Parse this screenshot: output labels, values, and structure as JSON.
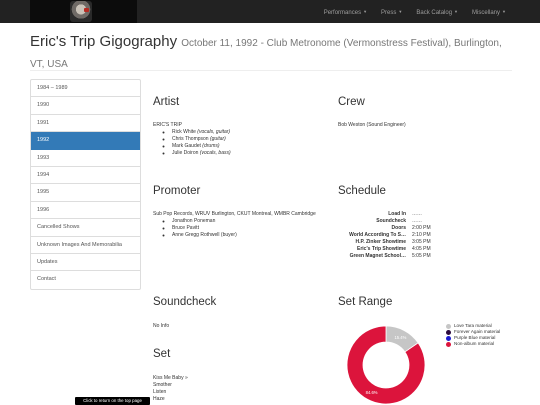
{
  "navbar": {
    "items": [
      {
        "label": "Performances"
      },
      {
        "label": "Press"
      },
      {
        "label": "Back Catalog"
      },
      {
        "label": "Miscellany"
      }
    ]
  },
  "header": {
    "title": "Eric's Trip Gigography",
    "subtitle": "October 11, 1992 - Club Metronome (Vermonstress Festival), Burlington, VT, USA"
  },
  "sidebar": {
    "items": [
      {
        "label": "1984 – 1989",
        "active": false
      },
      {
        "label": "1990",
        "active": false
      },
      {
        "label": "1991",
        "active": false
      },
      {
        "label": "1992",
        "active": true
      },
      {
        "label": "1993",
        "active": false
      },
      {
        "label": "1994",
        "active": false
      },
      {
        "label": "1995",
        "active": false
      },
      {
        "label": "1996",
        "active": false
      },
      {
        "label": "Cancelled Shows",
        "active": false
      },
      {
        "label": "Unknown Images And Memorabilia",
        "active": false
      },
      {
        "label": "Updates",
        "active": false
      },
      {
        "label": "Contact",
        "active": false
      }
    ]
  },
  "artist": {
    "heading": "Artist",
    "band": "ERIC'S TRIP",
    "members": [
      {
        "name": "Rick White",
        "role": "(vocals, guitar)"
      },
      {
        "name": "Chris Thompson",
        "role": "(guitar)"
      },
      {
        "name": "Mark Gaudet",
        "role": "(drums)"
      },
      {
        "name": "Julie Doiron",
        "role": "(vocals, bass)"
      }
    ]
  },
  "crew": {
    "heading": "Crew",
    "text": "Bob Weston (Sound Engineer)"
  },
  "promoter": {
    "heading": "Promoter",
    "text": "Sub Pop Records, WRUV Burlington, CKUT Montreal, WMBR Cambridge",
    "people": [
      "Jonathon Poneman",
      "Bruce Pavitt",
      "Anne Gregg Rothwell (buyer)"
    ]
  },
  "schedule": {
    "heading": "Schedule",
    "rows": [
      {
        "label": "Load In",
        "value": "……"
      },
      {
        "label": "Soundcheck",
        "value": "……"
      },
      {
        "label": "Doors",
        "value": "2:00 PM"
      },
      {
        "label": "World According To S…",
        "value": "2:10 PM"
      },
      {
        "label": "H.P. Zinker Showtime",
        "value": "3:05 PM"
      },
      {
        "label": "Eric's Trip Showtime",
        "value": "4:05 PM"
      },
      {
        "label": "Green Magnet School…",
        "value": "5:05 PM"
      }
    ]
  },
  "soundcheck": {
    "heading": "Soundcheck",
    "text": "No Info"
  },
  "set": {
    "heading": "Set",
    "songs": [
      "Kiss Me Baby »",
      "Smother",
      "Listen",
      "Haze"
    ]
  },
  "set_range": {
    "heading": "Set Range",
    "slices": [
      {
        "label": "Love Tara material",
        "percent": 15.4,
        "color": "#c6c6c6",
        "text": "15.4%"
      },
      {
        "label": "Forever Again material",
        "percent": 0,
        "color": "#2b0a3d",
        "text": ""
      },
      {
        "label": "Purple Blue material",
        "percent": 0,
        "color": "#1c1ccf",
        "text": ""
      },
      {
        "label": "Non-album material",
        "percent": 84.6,
        "color": "#dc143c",
        "text": "84.6%"
      }
    ]
  },
  "tooltip": {
    "text": "Click to return on the top page"
  }
}
